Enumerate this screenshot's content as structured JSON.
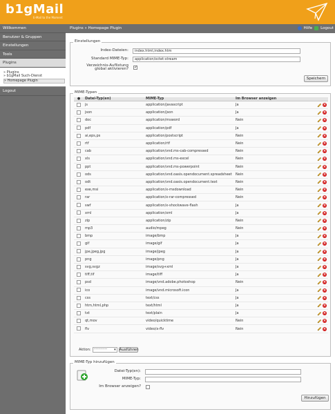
{
  "app": {
    "logo": "b1gMail",
    "slogan": "E-Mail to the Moment",
    "brand_color": "#f0a01a"
  },
  "sidebar": {
    "items": [
      {
        "label": "Willkommen"
      },
      {
        "label": "Benutzer & Gruppen"
      },
      {
        "label": "Einstellungen"
      },
      {
        "label": "Tools"
      },
      {
        "label": "Plugins"
      }
    ],
    "subitems": [
      {
        "label": "» Plugins"
      },
      {
        "label": "» b1gMail Such-Dienst"
      },
      {
        "label": "» Homepage Plugin"
      }
    ],
    "logout": "Logout"
  },
  "topbar": {
    "breadcrumb": "Plugins » Homepage Plugin",
    "help": "Hilfe",
    "logout": "Logout"
  },
  "settings": {
    "legend": "Einstellungen",
    "index_label": "Index-Dateien:",
    "index_value": "index.html,index.htm",
    "mime_label": "Standard MIME-Typ:",
    "mime_value": "application/octet-stream",
    "listing_label_1": "Verzeichnis-Auflistung",
    "listing_label_2": "global aktivieren?",
    "listing_checked": true,
    "save_button": "Speichern"
  },
  "mime_types": {
    "legend": "MIME-Typen",
    "headers": [
      "Datei-Typ(en)",
      "MIME-Typ",
      "Im Browser anzeigen"
    ],
    "rows": [
      {
        "ext": "js",
        "mime": "application/javascript",
        "browser": "Ja"
      },
      {
        "ext": "json",
        "mime": "application/json",
        "browser": "Ja"
      },
      {
        "ext": "doc",
        "mime": "application/msword",
        "browser": "Nein"
      },
      {
        "ext": "pdf",
        "mime": "application/pdf",
        "browser": "Ja"
      },
      {
        "ext": "ai,eps,ps",
        "mime": "application/postscript",
        "browser": "Nein"
      },
      {
        "ext": "rtf",
        "mime": "application/rtf",
        "browser": "Nein"
      },
      {
        "ext": "cab",
        "mime": "application/vnd.ms-cab-compressed",
        "browser": "Nein"
      },
      {
        "ext": "xls",
        "mime": "application/vnd.ms-excel",
        "browser": "Nein"
      },
      {
        "ext": "ppt",
        "mime": "application/vnd.ms-powerpoint",
        "browser": "Nein"
      },
      {
        "ext": "ods",
        "mime": "application/vnd.oasis.opendocument.spreadsheet",
        "browser": "Nein"
      },
      {
        "ext": "odt",
        "mime": "application/vnd.oasis.opendocument.text",
        "browser": "Nein"
      },
      {
        "ext": "exe,msi",
        "mime": "application/x-msdownload",
        "browser": "Nein"
      },
      {
        "ext": "rar",
        "mime": "application/x-rar-compressed",
        "browser": "Nein"
      },
      {
        "ext": "swf",
        "mime": "application/x-shockwave-flash",
        "browser": "Ja"
      },
      {
        "ext": "xml",
        "mime": "application/xml",
        "browser": "Ja"
      },
      {
        "ext": "zip",
        "mime": "application/zip",
        "browser": "Nein"
      },
      {
        "ext": "mp3",
        "mime": "audio/mpeg",
        "browser": "Nein"
      },
      {
        "ext": "bmp",
        "mime": "image/bmp",
        "browser": "Ja"
      },
      {
        "ext": "gif",
        "mime": "image/gif",
        "browser": "Ja"
      },
      {
        "ext": "jpe,jpeg,jpg",
        "mime": "image/jpeg",
        "browser": "Ja"
      },
      {
        "ext": "png",
        "mime": "image/png",
        "browser": "Ja"
      },
      {
        "ext": "svg,svgz",
        "mime": "image/svg+xml",
        "browser": "Ja"
      },
      {
        "ext": "tiff,tif",
        "mime": "image/tiff",
        "browser": "Ja"
      },
      {
        "ext": "psd",
        "mime": "image/vnd.adobe.photoshop",
        "browser": "Nein"
      },
      {
        "ext": "ico",
        "mime": "image/vnd.microsoft.icon",
        "browser": "Ja"
      },
      {
        "ext": "css",
        "mime": "text/css",
        "browser": "Ja"
      },
      {
        "ext": "htm,html,php",
        "mime": "text/html",
        "browser": "Ja"
      },
      {
        "ext": "txt",
        "mime": "text/plain",
        "browser": "Ja"
      },
      {
        "ext": "qt,mov",
        "mime": "video/quicktime",
        "browser": "Nein"
      },
      {
        "ext": "flv",
        "mime": "video/x-flv",
        "browser": "Nein"
      }
    ],
    "action_label": "Aktion:",
    "action_select": "------------",
    "run_button": "Ausführen"
  },
  "add_mime": {
    "legend": "MIME-Typ hinzufügen",
    "ext_label": "Datei-Typ(en):",
    "mime_label": "MIME-Typ:",
    "browser_label": "Im Browser anzeigen?",
    "add_button": "Hinzufügen"
  }
}
